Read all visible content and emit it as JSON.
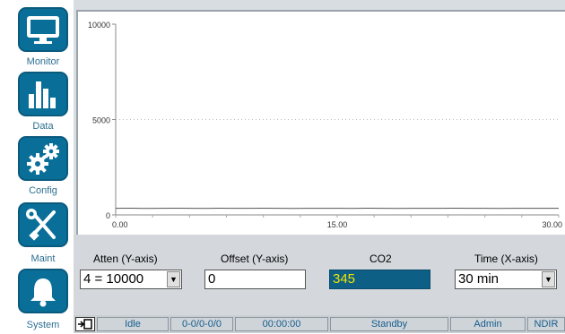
{
  "nav": [
    {
      "label": "Monitor",
      "icon": "monitor-icon"
    },
    {
      "label": "Data",
      "icon": "bar-chart-icon"
    },
    {
      "label": "Config",
      "icon": "gears-icon"
    },
    {
      "label": "Maint",
      "icon": "tools-icon"
    },
    {
      "label": "System",
      "icon": "bell-icon"
    }
  ],
  "chart_data": {
    "type": "line",
    "x_tick_labels": [
      "0.00",
      "15.00",
      "30.00"
    ],
    "y_tick_labels": [
      "0",
      "5000",
      "10000"
    ],
    "xlim": [
      0,
      30
    ],
    "ylim": [
      0,
      10000
    ],
    "grid": "dotted horizontal at 5000",
    "series": [
      {
        "color": "#555555",
        "x": [
          0,
          1,
          2,
          3,
          4,
          5,
          6,
          7,
          8,
          9,
          10,
          11,
          12,
          13,
          14,
          15,
          16,
          17,
          18,
          19,
          20,
          21,
          22,
          23,
          24,
          25,
          26,
          27,
          28,
          29,
          30
        ],
        "values": [
          345,
          350,
          340,
          348,
          352,
          345,
          338,
          350,
          346,
          344,
          351,
          347,
          342,
          349,
          345,
          346,
          343,
          350,
          345,
          341,
          348,
          346,
          344,
          350,
          345,
          347,
          343,
          349,
          345,
          346,
          345
        ]
      }
    ]
  },
  "controls": {
    "atten_label": "Atten (Y-axis)",
    "atten_value": "4 = 10000",
    "offset_label": "Offset (Y-axis)",
    "offset_value": "0",
    "co2_label": "CO2",
    "co2_value": "345",
    "time_label": "Time (X-axis)",
    "time_value": "30 min"
  },
  "status": {
    "state": "Idle",
    "range": "0-0/0-0/0",
    "timer": "00:00:00",
    "mode": "Standby",
    "user": "Admin",
    "sensor": "NDIR"
  },
  "colors": {
    "accent": "#0a6f98",
    "co2_field_bg": "#0d5f86",
    "co2_text": "#f2e600",
    "status_text": "#145c8c"
  }
}
